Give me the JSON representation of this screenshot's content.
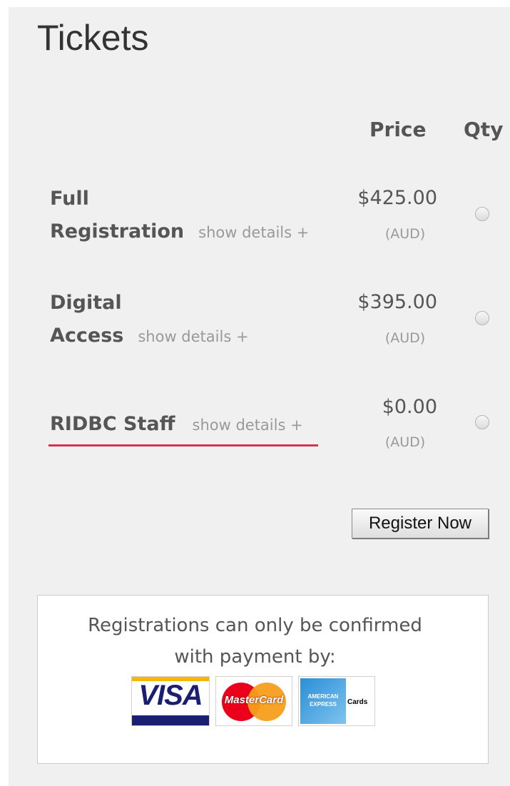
{
  "section_title": "Tickets",
  "columns": {
    "price": "Price",
    "qty": "Qty"
  },
  "tickets": [
    {
      "name_line1": "Full",
      "name_line2": "Registration",
      "details_label": "show details +",
      "price": "$425.00",
      "currency": "(AUD)"
    },
    {
      "name_line1": "Digital",
      "name_line2": "Access",
      "details_label": "show details +",
      "price": "$395.00",
      "currency": "(AUD)"
    },
    {
      "name_line1": "RIDBC Staff",
      "details_label": "show details +",
      "price": "$0.00",
      "currency": "(AUD)"
    }
  ],
  "register_button": "Register Now",
  "payment": {
    "line1": "Registrations can only be confirmed",
    "line2": "with payment by:",
    "cards": [
      {
        "name": "VISA",
        "icon": "visa-logo"
      },
      {
        "name": "MasterCard",
        "icon": "mastercard-logo"
      },
      {
        "name": "Cards",
        "brand_line1": "AMERICAN",
        "brand_line2": "EXPRESS",
        "icon": "amex-logo"
      }
    ]
  },
  "colors": {
    "panel_bg": "#f0f0f0",
    "text": "#555555",
    "muted": "#999999",
    "accent_underline": "#d4344f"
  }
}
